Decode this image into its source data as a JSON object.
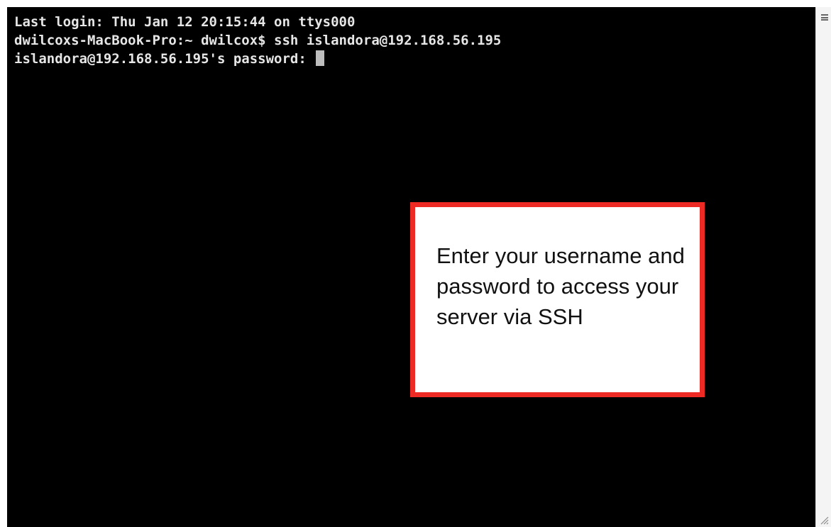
{
  "terminal": {
    "lines": [
      "Last login: Thu Jan 12 20:15:44 on ttys000",
      "dwilcoxs-MacBook-Pro:~ dwilcox$ ssh islandora@192.168.56.195",
      "islandora@192.168.56.195's password: "
    ]
  },
  "callout": {
    "text": "Enter your username and password to access your server via SSH",
    "border_color": "#ee2a24"
  },
  "icons": {
    "scroll_menu": "menu-icon",
    "resize": "resize-grip-icon"
  }
}
